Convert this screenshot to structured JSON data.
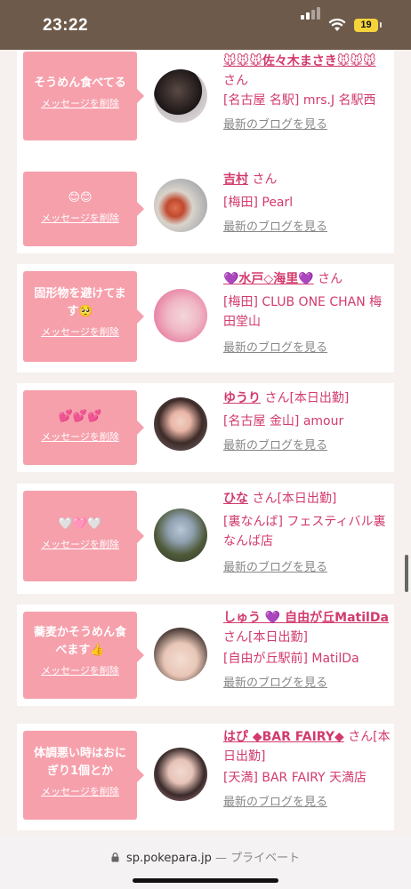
{
  "status": {
    "time": "23:22",
    "battery": "19"
  },
  "cards": [
    {
      "message": "そうめん食べてる",
      "delete_label": "メッセージを削除",
      "name": "🐭🐭🐭佐々木まさき🐭🐭🐭",
      "honorific": "さん",
      "shop": "[名古屋 名駅] mrs.J 名駅西",
      "blog_link": "最新のブログを見る"
    },
    {
      "message": "😊😊",
      "delete_label": "メッセージを削除",
      "name": "吉村",
      "honorific": "さん",
      "shop": "[梅田] Pearl",
      "blog_link": "最新のブログを見る"
    },
    {
      "message": "固形物を避けてます🥺",
      "delete_label": "メッセージを削除",
      "name": "💜水戸◇海里💜",
      "honorific": "さん",
      "shop": "[梅田] CLUB ONE CHAN 梅田堂山",
      "blog_link": "最新のブログを見る"
    },
    {
      "message": "💕💕💕",
      "delete_label": "メッセージを削除",
      "name": "ゆうり",
      "honorific": "さん[本日出勤]",
      "shop": "[名古屋 金山] amour",
      "blog_link": "最新のブログを見る"
    },
    {
      "message": "🤍🩷🤍",
      "delete_label": "メッセージを削除",
      "name": "ひな",
      "honorific": "さん[本日出勤]",
      "shop": "[裏なんば] フェスティバル裏なんば店",
      "blog_link": "最新のブログを見る"
    },
    {
      "message": "蕎麦かそうめん食べます👍",
      "delete_label": "メッセージを削除",
      "name": "しゅう 💜 自由が丘MatilDa",
      "honorific": "さん[本日出勤]",
      "shop": "[自由が丘駅前] MatilDa",
      "blog_link": "最新のブログを見る"
    },
    {
      "message": "体調悪い時はおにぎり1個とか",
      "delete_label": "メッセージを削除",
      "name": "はぴ ◆BAR FAIRY◆",
      "honorific": "さん[本日出勤]",
      "shop": "[天満] BAR FAIRY 天満店",
      "blog_link": "最新のブログを見る"
    }
  ],
  "browser": {
    "domain": "sp.pokepara.jp",
    "separator": "—",
    "privacy": "プライベート"
  },
  "icons": {
    "lock": "lock-icon",
    "wifi": "wifi-icon",
    "signal": "signal-icon"
  }
}
